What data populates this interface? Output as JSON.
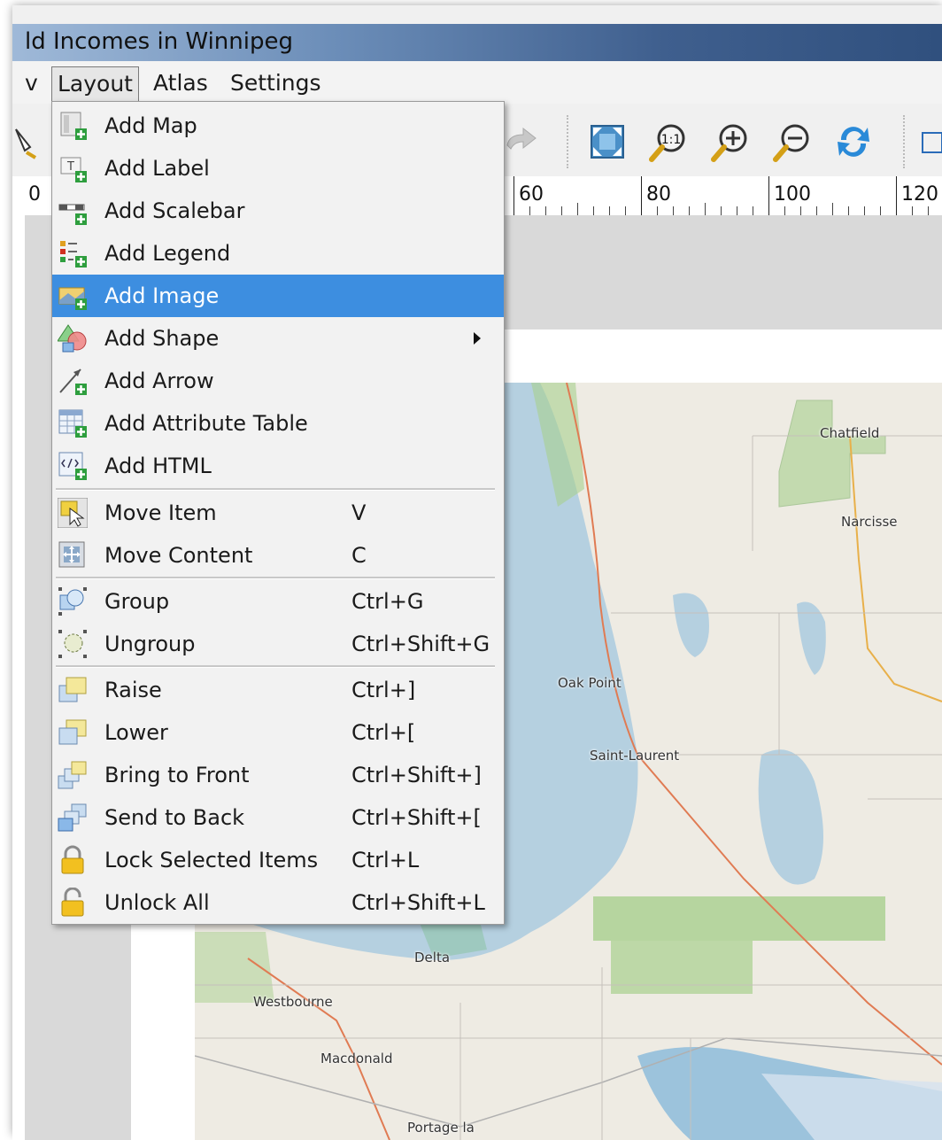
{
  "window": {
    "title": "ld Incomes in Winnipeg"
  },
  "menubar": {
    "items": [
      {
        "label": "v"
      },
      {
        "label": "Layout"
      },
      {
        "label": "Atlas"
      },
      {
        "label": "Settings"
      }
    ]
  },
  "toolbar": {
    "icons": [
      "redo-icon",
      "zoom-full-icon",
      "zoom-actual-icon",
      "zoom-in-icon",
      "zoom-out-icon",
      "refresh-icon",
      "select-icon"
    ],
    "zoom_actual_text": "1:1"
  },
  "ruler": {
    "labels": [
      "0",
      "60",
      "80",
      "100",
      "120"
    ]
  },
  "menu": {
    "items": [
      {
        "label": "Add Map",
        "icon": "add-map-icon"
      },
      {
        "label": "Add Label",
        "icon": "add-label-icon"
      },
      {
        "label": "Add Scalebar",
        "icon": "add-scalebar-icon"
      },
      {
        "label": "Add Legend",
        "icon": "add-legend-icon"
      },
      {
        "label": "Add Image",
        "icon": "add-image-icon",
        "highlighted": true
      },
      {
        "label": "Add Shape",
        "icon": "add-shape-icon",
        "submenu": true
      },
      {
        "label": "Add Arrow",
        "icon": "add-arrow-icon"
      },
      {
        "label": "Add Attribute Table",
        "icon": "add-attribute-table-icon"
      },
      {
        "label": "Add HTML",
        "icon": "add-html-icon"
      },
      {
        "label": "Move Item",
        "shortcut": "V",
        "icon": "move-item-icon"
      },
      {
        "label": "Move Content",
        "shortcut": "C",
        "icon": "move-content-icon"
      },
      {
        "label": "Group",
        "shortcut": "Ctrl+G",
        "icon": "group-icon"
      },
      {
        "label": "Ungroup",
        "shortcut": "Ctrl+Shift+G",
        "icon": "ungroup-icon"
      },
      {
        "label": "Raise",
        "shortcut": "Ctrl+]",
        "icon": "raise-icon"
      },
      {
        "label": "Lower",
        "shortcut": "Ctrl+[",
        "icon": "lower-icon"
      },
      {
        "label": "Bring to Front",
        "shortcut": "Ctrl+Shift+]",
        "icon": "bring-to-front-icon"
      },
      {
        "label": "Send to Back",
        "shortcut": "Ctrl+Shift+[",
        "icon": "send-to-back-icon"
      },
      {
        "label": "Lock Selected Items",
        "shortcut": "Ctrl+L",
        "icon": "lock-icon"
      },
      {
        "label": "Unlock All",
        "shortcut": "Ctrl+Shift+L",
        "icon": "unlock-icon"
      }
    ]
  },
  "map": {
    "places": [
      "Chatfield",
      "Narcisse",
      "Oak Point",
      "Saint-Laurent",
      "Delta",
      "Westbourne",
      "Macdonald",
      "Portage la"
    ]
  },
  "colors": {
    "highlight": "#3d8ee0",
    "water": "#b5d0e0",
    "land": "#eeebe3",
    "park": "#a8d08d",
    "road": "#e07b53"
  }
}
